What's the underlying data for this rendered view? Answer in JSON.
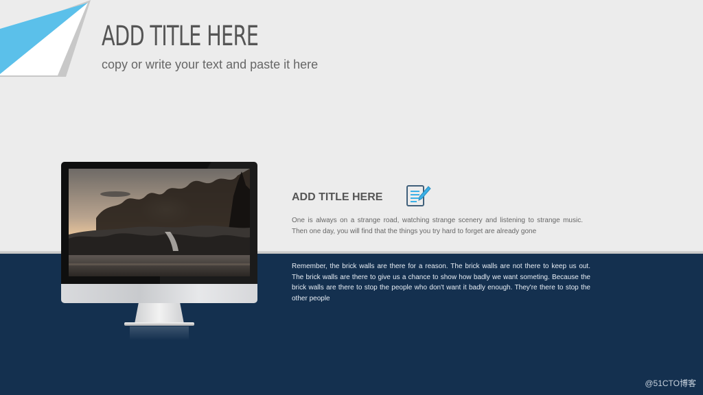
{
  "header": {
    "title": "ADD TITLE HERE",
    "subtitle": "copy or write your text and paste it here"
  },
  "content": {
    "section_title": "ADD TITLE HERE",
    "paragraph_1": "One is always on a strange road, watching strange scenery and listening to strange music. Then one day, you will find that the things you try hard to forget are already gone",
    "paragraph_2": "Remember, the brick walls are there for a reason. The brick walls are not there to keep us out. The brick walls are there to give us a chance to show how badly we want someting. Because the brick walls are there to stop the people who don't want it badly enough. They're there to stop the other people"
  },
  "watermark": "@51CTO博客",
  "icons": {
    "corner": "page-curl-corner",
    "section": "edit-document-icon"
  },
  "colors": {
    "background": "#ececec",
    "band": "#14304f",
    "accent": "#5bc0ea"
  }
}
